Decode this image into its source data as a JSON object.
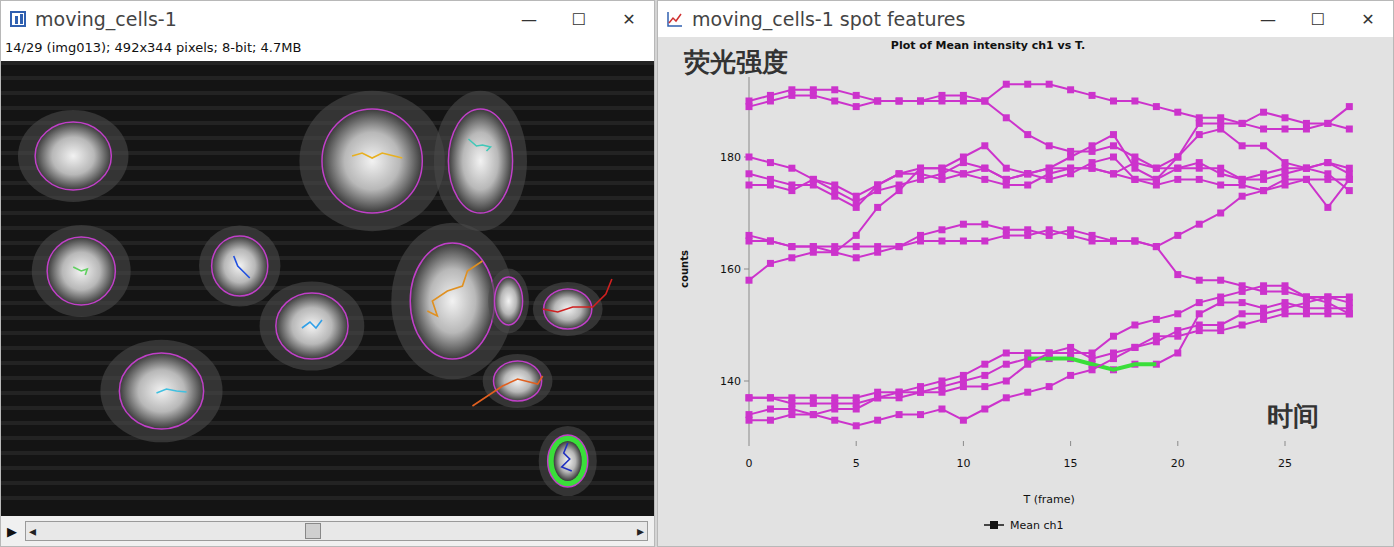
{
  "image_window": {
    "title": "moving_cells-1",
    "controls": [
      "—",
      "☐",
      "✕"
    ],
    "info": "14/29 (img013); 492x344 pixels; 8-bit; 4.7MB",
    "image": {
      "cells": [
        {
          "track_color": null,
          "selected": false
        },
        {
          "track_color": "#e8b020",
          "selected": false
        },
        {
          "track_color": "#40c8b8",
          "selected": false
        },
        {
          "track_color": "#60d060",
          "selected": false
        },
        {
          "track_color": "#2050e0",
          "selected": false
        },
        {
          "track_color": "#30a0e8",
          "selected": false
        },
        {
          "track_color": "#e09020",
          "selected": false
        },
        {
          "track_color": null,
          "selected": false
        },
        {
          "track_color": "#d02020",
          "selected": false
        },
        {
          "track_color": "#40c0e0",
          "selected": false
        },
        {
          "track_color": "#e06020",
          "selected": false
        },
        {
          "track_color": "#2030c0",
          "selected": true
        }
      ]
    },
    "scrollbar": {
      "play": "▶",
      "left_arrow": "◂",
      "right_arrow": "▸",
      "level": 0.46
    }
  },
  "plot_window": {
    "title": "moving_cells-1 spot features",
    "controls": [
      "—",
      "☐",
      "✕"
    ],
    "annotation_y": "荧光强度",
    "annotation_x": "时间",
    "chart": {
      "title": "Plot of Mean intensity ch1 vs T.",
      "y_label": "counts",
      "x_label": "T (frame)",
      "y_ticks": [
        "140",
        "160",
        "180"
      ],
      "x_ticks": [
        "0",
        "5",
        "10",
        "15",
        "20",
        "25"
      ],
      "legend": "Mean ch1",
      "series_color": "#cc33cc",
      "series": [
        {
          "values": [
            189,
            190,
            191,
            191,
            190,
            189,
            190,
            190,
            190,
            191,
            191,
            190,
            193,
            193,
            193,
            192,
            191,
            190,
            190,
            189,
            188,
            187,
            187,
            186,
            188,
            187,
            186,
            186,
            189
          ],
          "highlight": null
        },
        {
          "values": [
            190,
            191,
            192,
            192,
            192,
            191,
            190,
            190,
            190,
            190,
            190,
            190,
            187,
            184,
            182,
            181,
            181,
            182,
            180,
            178,
            180,
            186,
            186,
            186,
            185,
            185,
            185,
            186,
            185
          ],
          "highlight": null
        },
        {
          "values": [
            180,
            179,
            178,
            176,
            175,
            173,
            175,
            177,
            178,
            178,
            180,
            182,
            178,
            177,
            178,
            180,
            182,
            184,
            178,
            176,
            180,
            184,
            185,
            182,
            182,
            179,
            178,
            179,
            177
          ],
          "highlight": null
        },
        {
          "values": [
            177,
            176,
            175,
            175,
            173,
            171,
            175,
            177,
            177,
            176,
            177,
            178,
            176,
            177,
            178,
            178,
            178,
            177,
            179,
            178,
            178,
            179,
            177,
            176,
            177,
            178,
            178,
            179,
            178
          ],
          "highlight": null
        },
        {
          "values": [
            175,
            175,
            174,
            176,
            174,
            172,
            174,
            175,
            176,
            177,
            179,
            178,
            176,
            177,
            176,
            177,
            179,
            180,
            176,
            175,
            176,
            176,
            175,
            175,
            174,
            176,
            176,
            171,
            176
          ],
          "highlight": null
        },
        {
          "values": [
            166,
            165,
            164,
            164,
            163,
            166,
            171,
            174,
            178,
            178,
            177,
            176,
            175,
            175,
            177,
            178,
            178,
            177,
            176,
            176,
            178,
            178,
            178,
            176,
            176,
            177,
            178,
            177,
            174
          ],
          "highlight": null
        },
        {
          "values": [
            158,
            161,
            162,
            163,
            163,
            162,
            163,
            164,
            166,
            167,
            168,
            168,
            167,
            167,
            166,
            167,
            166,
            165,
            165,
            164,
            166,
            168,
            170,
            173,
            174,
            175,
            176,
            176,
            176
          ],
          "highlight": null
        },
        {
          "values": [
            165,
            165,
            164,
            164,
            164,
            164,
            164,
            164,
            165,
            165,
            165,
            165,
            166,
            166,
            167,
            166,
            165,
            165,
            165,
            164,
            159,
            158,
            158,
            157,
            156,
            156,
            155,
            155,
            154
          ],
          "highlight": null
        },
        {
          "values": [
            137,
            137,
            137,
            137,
            137,
            137,
            138,
            138,
            139,
            140,
            141,
            143,
            145,
            145,
            145,
            146,
            144,
            145,
            146,
            147,
            149,
            150,
            150,
            152,
            152,
            153,
            154,
            155,
            155
          ],
          "highlight": null
        },
        {
          "values": [
            137,
            137,
            136,
            136,
            136,
            136,
            137,
            138,
            138,
            139,
            140,
            141,
            143,
            144,
            144,
            144,
            143,
            142,
            143,
            143,
            145,
            152,
            154,
            154,
            153,
            154,
            153,
            153,
            153
          ],
          "highlight": {
            "from": 13,
            "to": 19,
            "color": "#3ade3a"
          }
        },
        {
          "values": [
            134,
            135,
            135,
            134,
            135,
            135,
            137,
            137,
            138,
            138,
            139,
            139,
            140,
            143,
            145,
            145,
            145,
            148,
            150,
            151,
            152,
            154,
            155,
            156,
            157,
            157,
            155,
            154,
            152
          ],
          "highlight": null
        },
        {
          "values": [
            133,
            133,
            134,
            134,
            133,
            132,
            133,
            134,
            134,
            135,
            133,
            135,
            137,
            138,
            139,
            141,
            142,
            144,
            146,
            148,
            148,
            149,
            149,
            150,
            151,
            152,
            152,
            152,
            152
          ],
          "highlight": null
        }
      ]
    }
  }
}
